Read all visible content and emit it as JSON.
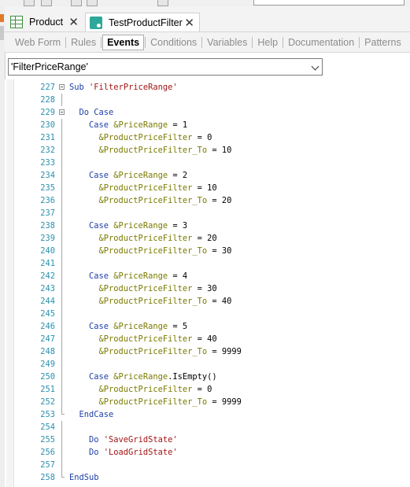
{
  "tabs": [
    {
      "label": "Product",
      "icon": "grid-icon"
    },
    {
      "label": "TestProductFilter",
      "icon": "procedure-icon"
    }
  ],
  "subtabs": [
    "Web Form",
    "Rules",
    "Events",
    "Conditions",
    "Variables",
    "Help",
    "Documentation",
    "Patterns"
  ],
  "active_subtab": "Events",
  "event_selector": {
    "value": "'FilterPriceRange'"
  },
  "code_lines": [
    {
      "n": "227",
      "fold": "box",
      "indent": 0,
      "t": [
        [
          "kw",
          "Sub "
        ],
        [
          "str",
          "'FilterPriceRange'"
        ]
      ]
    },
    {
      "n": "228",
      "fold": "guide",
      "indent": 0,
      "t": []
    },
    {
      "n": "229",
      "fold": "box",
      "indent": 2,
      "t": [
        [
          "kw",
          "Do Case"
        ]
      ]
    },
    {
      "n": "230",
      "fold": "guide",
      "indent": 4,
      "t": [
        [
          "kw",
          "Case "
        ],
        [
          "var",
          "&PriceRange"
        ],
        [
          "p",
          " = 1"
        ]
      ]
    },
    {
      "n": "231",
      "fold": "guide",
      "indent": 6,
      "t": [
        [
          "var",
          "&ProductPriceFilter"
        ],
        [
          "p",
          " = 0"
        ]
      ]
    },
    {
      "n": "232",
      "fold": "guide",
      "indent": 6,
      "t": [
        [
          "var",
          "&ProductPriceFilter_To"
        ],
        [
          "p",
          " = 10"
        ]
      ]
    },
    {
      "n": "233",
      "fold": "guide",
      "indent": 0,
      "t": []
    },
    {
      "n": "234",
      "fold": "guide",
      "indent": 4,
      "t": [
        [
          "kw",
          "Case "
        ],
        [
          "var",
          "&PriceRange"
        ],
        [
          "p",
          " = 2"
        ]
      ]
    },
    {
      "n": "235",
      "fold": "guide",
      "indent": 6,
      "t": [
        [
          "var",
          "&ProductPriceFilter"
        ],
        [
          "p",
          " = 10"
        ]
      ]
    },
    {
      "n": "236",
      "fold": "guide",
      "indent": 6,
      "t": [
        [
          "var",
          "&ProductPriceFilter_To"
        ],
        [
          "p",
          " = 20"
        ]
      ]
    },
    {
      "n": "237",
      "fold": "guide",
      "indent": 0,
      "t": []
    },
    {
      "n": "238",
      "fold": "guide",
      "indent": 4,
      "t": [
        [
          "kw",
          "Case "
        ],
        [
          "var",
          "&PriceRange"
        ],
        [
          "p",
          " = 3"
        ]
      ]
    },
    {
      "n": "239",
      "fold": "guide",
      "indent": 6,
      "t": [
        [
          "var",
          "&ProductPriceFilter"
        ],
        [
          "p",
          " = 20"
        ]
      ]
    },
    {
      "n": "240",
      "fold": "guide",
      "indent": 6,
      "t": [
        [
          "var",
          "&ProductPriceFilter_To"
        ],
        [
          "p",
          " = 30"
        ]
      ]
    },
    {
      "n": "241",
      "fold": "guide",
      "indent": 0,
      "t": []
    },
    {
      "n": "242",
      "fold": "guide",
      "indent": 4,
      "t": [
        [
          "kw",
          "Case "
        ],
        [
          "var",
          "&PriceRange"
        ],
        [
          "p",
          " = 4"
        ]
      ]
    },
    {
      "n": "243",
      "fold": "guide",
      "indent": 6,
      "t": [
        [
          "var",
          "&ProductPriceFilter"
        ],
        [
          "p",
          " = 30"
        ]
      ]
    },
    {
      "n": "244",
      "fold": "guide",
      "indent": 6,
      "t": [
        [
          "var",
          "&ProductPriceFilter_To"
        ],
        [
          "p",
          " = 40"
        ]
      ]
    },
    {
      "n": "245",
      "fold": "guide",
      "indent": 0,
      "t": []
    },
    {
      "n": "246",
      "fold": "guide",
      "indent": 4,
      "t": [
        [
          "kw",
          "Case "
        ],
        [
          "var",
          "&PriceRange"
        ],
        [
          "p",
          " = 5"
        ]
      ]
    },
    {
      "n": "247",
      "fold": "guide",
      "indent": 6,
      "t": [
        [
          "var",
          "&ProductPriceFilter"
        ],
        [
          "p",
          " = 40"
        ]
      ]
    },
    {
      "n": "248",
      "fold": "guide",
      "indent": 6,
      "t": [
        [
          "var",
          "&ProductPriceFilter_To"
        ],
        [
          "p",
          " = 9999"
        ]
      ]
    },
    {
      "n": "249",
      "fold": "guide",
      "indent": 0,
      "t": []
    },
    {
      "n": "250",
      "fold": "guide",
      "indent": 4,
      "t": [
        [
          "kw",
          "Case "
        ],
        [
          "var",
          "&PriceRange"
        ],
        [
          "p",
          ".IsEmpty()"
        ]
      ]
    },
    {
      "n": "251",
      "fold": "guide",
      "indent": 6,
      "t": [
        [
          "var",
          "&ProductPriceFilter"
        ],
        [
          "p",
          " = 0"
        ]
      ]
    },
    {
      "n": "252",
      "fold": "guide",
      "indent": 6,
      "t": [
        [
          "var",
          "&ProductPriceFilter_To"
        ],
        [
          "p",
          " = 9999"
        ]
      ]
    },
    {
      "n": "253",
      "fold": "end",
      "indent": 2,
      "t": [
        [
          "kw",
          "EndCase"
        ]
      ]
    },
    {
      "n": "254",
      "fold": "guide",
      "indent": 0,
      "t": []
    },
    {
      "n": "255",
      "fold": "guide",
      "indent": 4,
      "t": [
        [
          "kw",
          "Do "
        ],
        [
          "str",
          "'SaveGridState'"
        ]
      ]
    },
    {
      "n": "256",
      "fold": "guide",
      "indent": 4,
      "t": [
        [
          "kw",
          "Do "
        ],
        [
          "str",
          "'LoadGridState'"
        ]
      ]
    },
    {
      "n": "257",
      "fold": "guide",
      "indent": 0,
      "t": []
    },
    {
      "n": "258",
      "fold": "end",
      "indent": 0,
      "t": [
        [
          "kw",
          "EndSub"
        ]
      ]
    }
  ],
  "colors": {
    "line_number": "#2b91af",
    "keyword": "#1f3fa8",
    "variable": "#7a7a00",
    "string": "#a31515"
  }
}
